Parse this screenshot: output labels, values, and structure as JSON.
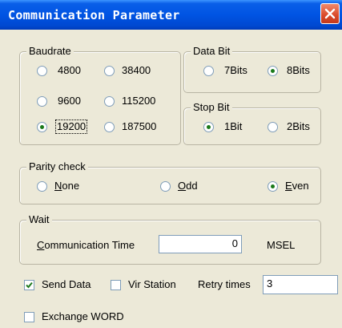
{
  "window": {
    "title": "Communication Parameter"
  },
  "baudrate": {
    "label": "Baudrate",
    "options": [
      "4800",
      "38400",
      "9600",
      "115200",
      "19200",
      "187500"
    ],
    "selected": "19200"
  },
  "data_bit": {
    "label": "Data Bit",
    "options": [
      "7Bits",
      "8Bits"
    ],
    "selected": "8Bits"
  },
  "stop_bit": {
    "label": "Stop Bit",
    "options": [
      "1Bit",
      "2Bits"
    ],
    "selected": "1Bit"
  },
  "parity": {
    "label": "Parity check",
    "options": [
      {
        "mnemonic": "N",
        "rest": "one"
      },
      {
        "mnemonic": "O",
        "rest": "dd"
      },
      {
        "mnemonic": "E",
        "rest": "ven"
      }
    ],
    "selected": "Even"
  },
  "wait": {
    "label": "Wait",
    "comm_time_label_mnemonic": "C",
    "comm_time_label_rest": "ommunication Time",
    "comm_time_value": "0",
    "unit": "MSEL"
  },
  "send_data": {
    "label": "Send Data",
    "checked": true
  },
  "vir_station": {
    "label": "Vir Station",
    "checked": false
  },
  "retry": {
    "label": "Retry times",
    "value": "3"
  },
  "exchange_word": {
    "label": "Exchange WORD",
    "checked": false
  }
}
